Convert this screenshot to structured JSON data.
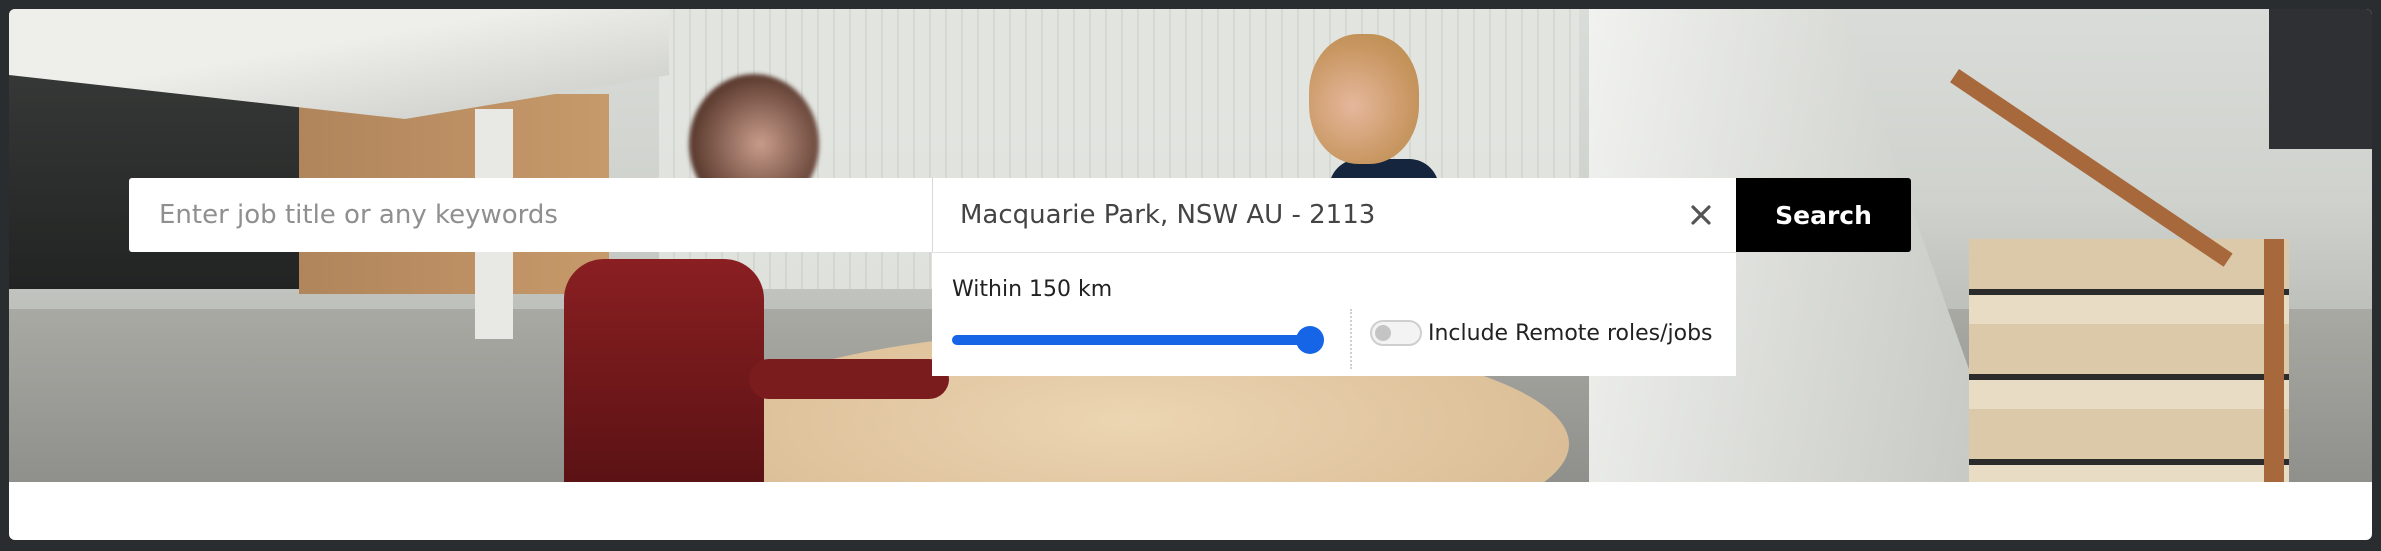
{
  "search": {
    "keyword_placeholder": "Enter job title or any keywords",
    "keyword_value": "",
    "location_value": "Macquarie Park, NSW AU - 2113",
    "clear_icon": "close-icon",
    "button_label": "Search"
  },
  "radius": {
    "label": "Within 150 km",
    "value_km": 150,
    "fill_fraction": 1.0,
    "accent_color": "#1565e6"
  },
  "remote": {
    "label": "Include Remote roles/jobs",
    "enabled": false
  },
  "colors": {
    "search_button": "#000000",
    "accent": "#1565e6"
  }
}
